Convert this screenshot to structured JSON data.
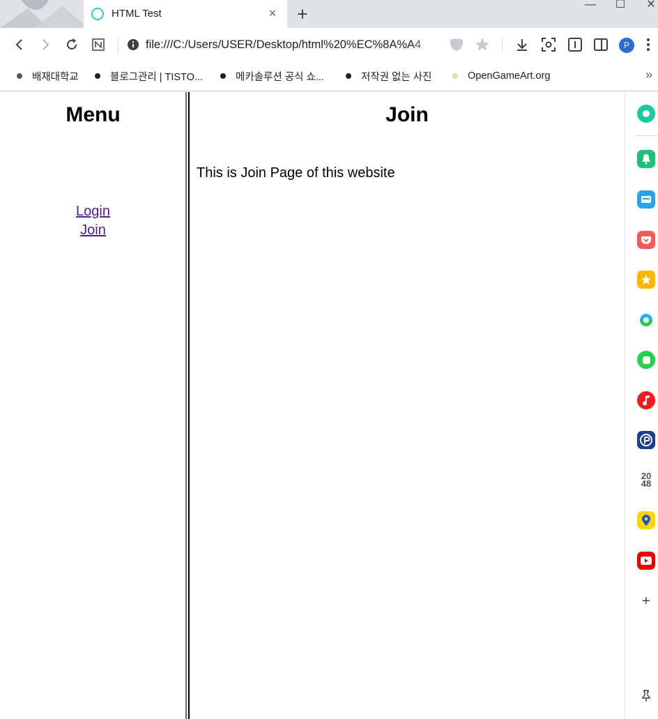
{
  "browser": {
    "tab": {
      "title": "HTML Test",
      "close_glyph": "×"
    },
    "new_tab_glyph": "+",
    "window_controls": {
      "minimize": "—",
      "maximize": "☐",
      "close": "✕"
    },
    "address": {
      "url": "file:///C:/Users/USER/Desktop/html%20%EC%8A%A4"
    },
    "profile_initial": "P"
  },
  "bookmarks": [
    {
      "label": "배재대학교",
      "icon": "bookmark-dot-icon"
    },
    {
      "label": "블로그관리 | TISTO...",
      "icon": "bookmark-dot-icon"
    },
    {
      "label": "메카솔루션 공식 쇼...",
      "icon": "bookmark-dot-icon"
    },
    {
      "label": "저작권 없는 사진",
      "icon": "bookmark-dot-icon"
    },
    {
      "label": "OpenGameArt.org",
      "icon": "bookmark-dot-icon"
    }
  ],
  "bookmarks_overflow": "»",
  "menu_frame": {
    "title": "Menu",
    "links": [
      {
        "label": "Login"
      },
      {
        "label": "Join"
      }
    ]
  },
  "content_frame": {
    "title": "Join",
    "body": "This is Join Page of this website"
  },
  "side_panel": {
    "number_tile": "20\n48",
    "add_glyph": "+"
  },
  "colors": {
    "tabbar_bg": "#dfe3e7",
    "visited_link": "#551a8b",
    "profile": "#2e6bd8"
  }
}
